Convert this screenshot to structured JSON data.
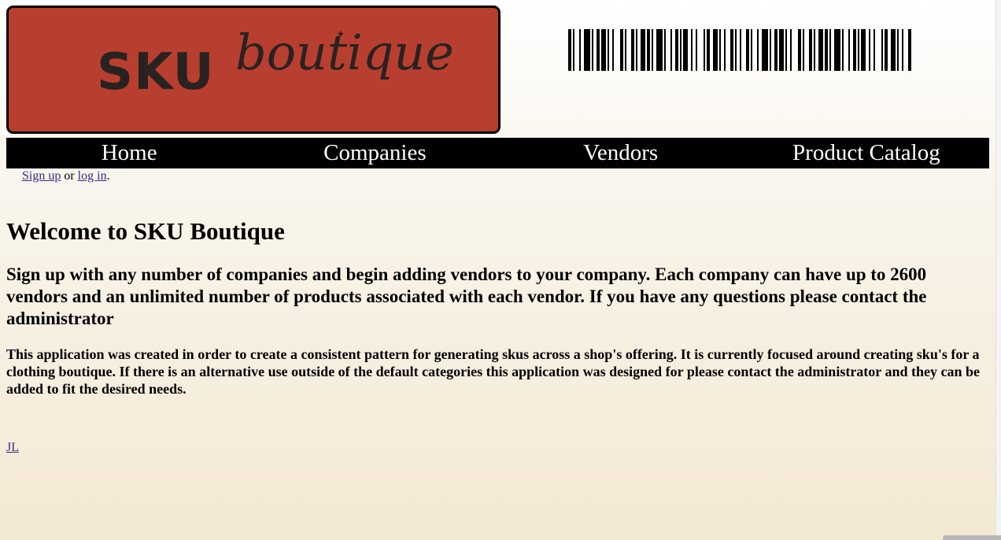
{
  "header": {
    "logo_primary": "SKU",
    "logo_secondary": "boutique",
    "brand_color": "#b83f30"
  },
  "nav": {
    "items": [
      {
        "label": "Home"
      },
      {
        "label": "Companies"
      },
      {
        "label": "Vendors"
      },
      {
        "label": "Product Catalog"
      }
    ]
  },
  "auth": {
    "signup_label": "Sign up",
    "separator": " or ",
    "login_label": "log in",
    "suffix": "."
  },
  "main": {
    "title": "Welcome to SKU Boutique",
    "intro": "Sign up with any number of companies and begin adding vendors to your company. Each company can have up to 2600 vendors and an unlimited number of products associated with each vendor. If you have any questions please contact the administrator",
    "description": "This application was created in order to create a consistent pattern for generating skus across a shop's offering. It is currently focused around creating sku's for a clothing boutique. If there is an alternative use outside of the default categories this application was designed for please contact the administrator and they can be added to fit the desired needs."
  },
  "footer": {
    "author_link": "JL"
  },
  "icons": {
    "barcode": "barcode-icon"
  }
}
